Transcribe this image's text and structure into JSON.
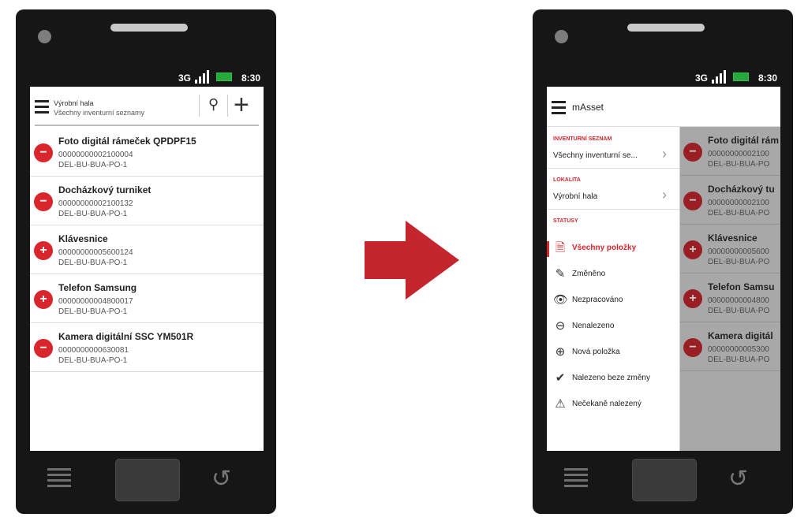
{
  "status": {
    "network": "3G",
    "time": "8:30"
  },
  "left": {
    "header": {
      "location": "Výrobní hala",
      "subtitle": "Všechny inventurní seznamy"
    },
    "items": [
      {
        "badge": "−",
        "title": "Foto digitál rámeček QPDPF15",
        "code": "00000000002100004",
        "location": "DEL-BU-BUA-PO-1"
      },
      {
        "badge": "−",
        "title": "Docházkový turniket",
        "code": "00000000002100132",
        "location": "DEL-BU-BUA-PO-1"
      },
      {
        "badge": "+",
        "title": "Klávesnice",
        "code": "00000000005600124",
        "location": "DEL-BU-BUA-PO-1"
      },
      {
        "badge": "+",
        "title": "Telefon Samsung",
        "code": "00000000004800017",
        "location": "DEL-BU-BUA-PO-1"
      },
      {
        "badge": "−",
        "title": "Kamera digitální SSC YM501R",
        "code": "0000000000630081",
        "location": "DEL-BU-BUA-PO-1"
      }
    ]
  },
  "right": {
    "header": {
      "title": "mAsset"
    },
    "drawer": {
      "inventory_label": "INVENTURNÍ SEZNAM",
      "inventory_value": "Všechny inventurní se...",
      "location_label": "LOKALITA",
      "location_value": "Výrobní hala",
      "statuses_label": "STATUSY",
      "statuses": [
        {
          "icon": "document-icon",
          "label": "Všechny položky",
          "active": true
        },
        {
          "icon": "pencil-icon",
          "label": "Změněno",
          "active": false
        },
        {
          "icon": "eye-icon",
          "label": "Nezpracováno",
          "active": false
        },
        {
          "icon": "minus-circle-icon",
          "label": "Nenalezeno",
          "active": false
        },
        {
          "icon": "plus-circle-icon",
          "label": "Nová položka",
          "active": false
        },
        {
          "icon": "check-icon",
          "label": "Nalezeno beze změny",
          "active": false
        },
        {
          "icon": "warning-icon",
          "label": "Nečekaně nalezený",
          "active": false
        }
      ]
    },
    "background_items": [
      {
        "badge": "−",
        "title": "Foto digitál rám",
        "code": "00000000002100",
        "location": "DEL-BU-BUA-PO"
      },
      {
        "badge": "−",
        "title": "Docházkový tu",
        "code": "00000000002100",
        "location": "DEL-BU-BUA-PO"
      },
      {
        "badge": "+",
        "title": "Klávesnice",
        "code": "00000000005600",
        "location": "DEL-BU-BUA-PO"
      },
      {
        "badge": "+",
        "title": "Telefon Samsu",
        "code": "00000000004800",
        "location": "DEL-BU-BUA-PO"
      },
      {
        "badge": "−",
        "title": "Kamera digitál",
        "code": "00000000005300",
        "location": "DEL-BU-BUA-PO"
      }
    ]
  },
  "colors": {
    "accent": "#d8262c",
    "phone": "#161616",
    "overlay": "#a8a8a8"
  }
}
